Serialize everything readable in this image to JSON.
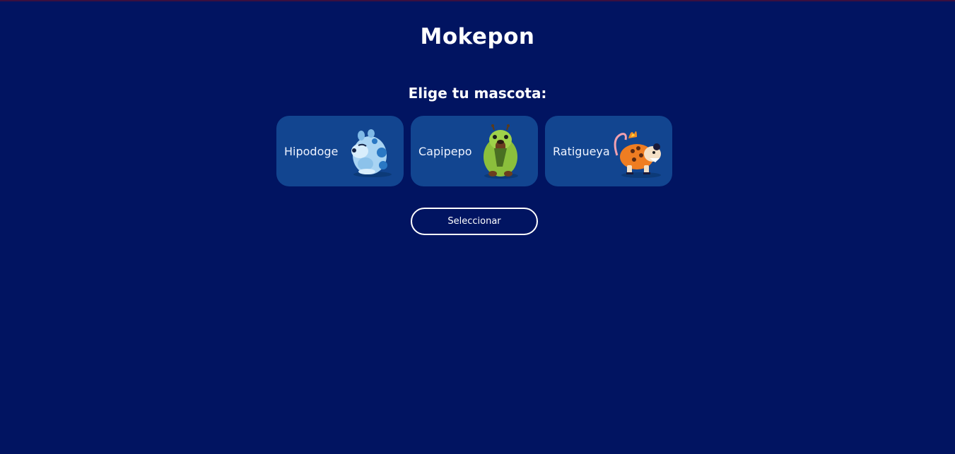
{
  "header": {
    "title": "Mokepon"
  },
  "main": {
    "prompt": "Elige tu mascota:",
    "pets": [
      {
        "name": "Hipodoge",
        "icon": "hipodoge-icon"
      },
      {
        "name": "Capipepo",
        "icon": "capipepo-icon"
      },
      {
        "name": "Ratigueya",
        "icon": "ratigueya-icon"
      }
    ],
    "select_label": "Seleccionar"
  },
  "colors": {
    "background": "#011461",
    "card": "#124590",
    "text": "#ffffff"
  }
}
